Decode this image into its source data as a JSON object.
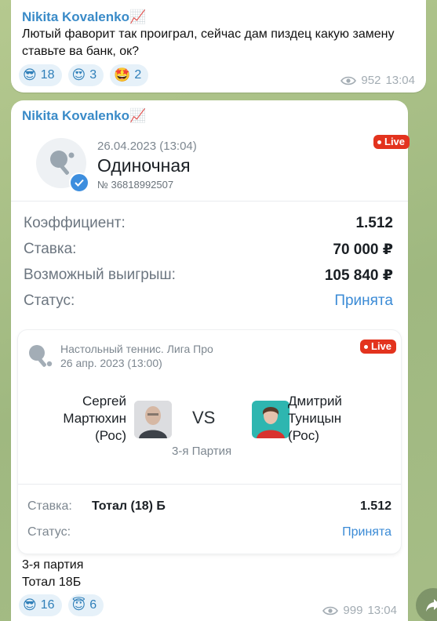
{
  "message1": {
    "sender": "Nikita Kovalenko📈",
    "text": "Лютый фаворит так проиграл, сейчас дам пиздец какую замену ставьте ва банк, ок?",
    "reactions": [
      {
        "emoji": "😎",
        "count": "18"
      },
      {
        "emoji": "😍",
        "count": "3"
      },
      {
        "emoji": "🤩",
        "count": "2"
      }
    ],
    "views": "952",
    "time": "13:04"
  },
  "message2": {
    "sender": "Nikita Kovalenko📈",
    "ticket": {
      "date": "26.04.2023 (13:04)",
      "type": "Одиночная",
      "number": "№ 36818992507",
      "live": "Live",
      "rows": [
        {
          "key": "Коэффициент:",
          "value": "1.512"
        },
        {
          "key": "Ставка:",
          "value": "70 000 ₽"
        },
        {
          "key": "Возможный выигрыш:",
          "value": "105 840 ₽"
        },
        {
          "key": "Статус:",
          "value": "Принята"
        }
      ]
    },
    "event": {
      "league": "Настольный теннис. Лига Про",
      "date": "26 апр. 2023 (13:00)",
      "live": "Live",
      "player1": {
        "line1": "Сергей",
        "line2": "Мартюхин",
        "line3": "(Рос)"
      },
      "vs": "VS",
      "player2": {
        "line1": "Дмитрий",
        "line2": "Туницын",
        "line3": "(Рос)"
      },
      "round": "3-я Партия",
      "bet_row": {
        "key": "Ставка:",
        "selection": "Тотал (18) Б",
        "value": "1.512"
      },
      "status_row": {
        "key": "Статус:",
        "value": "Принята"
      }
    },
    "text_line1": "3-я партия",
    "text_line2": "Тотал 18Б",
    "reactions": [
      {
        "emoji": "😎",
        "count": "16"
      },
      {
        "emoji": "😇",
        "count": "6"
      }
    ],
    "views": "999",
    "time": "13:04"
  },
  "colors": {
    "accent": "#3b8bd6",
    "live": "#e3331e",
    "sender": "#3a8bc8"
  }
}
